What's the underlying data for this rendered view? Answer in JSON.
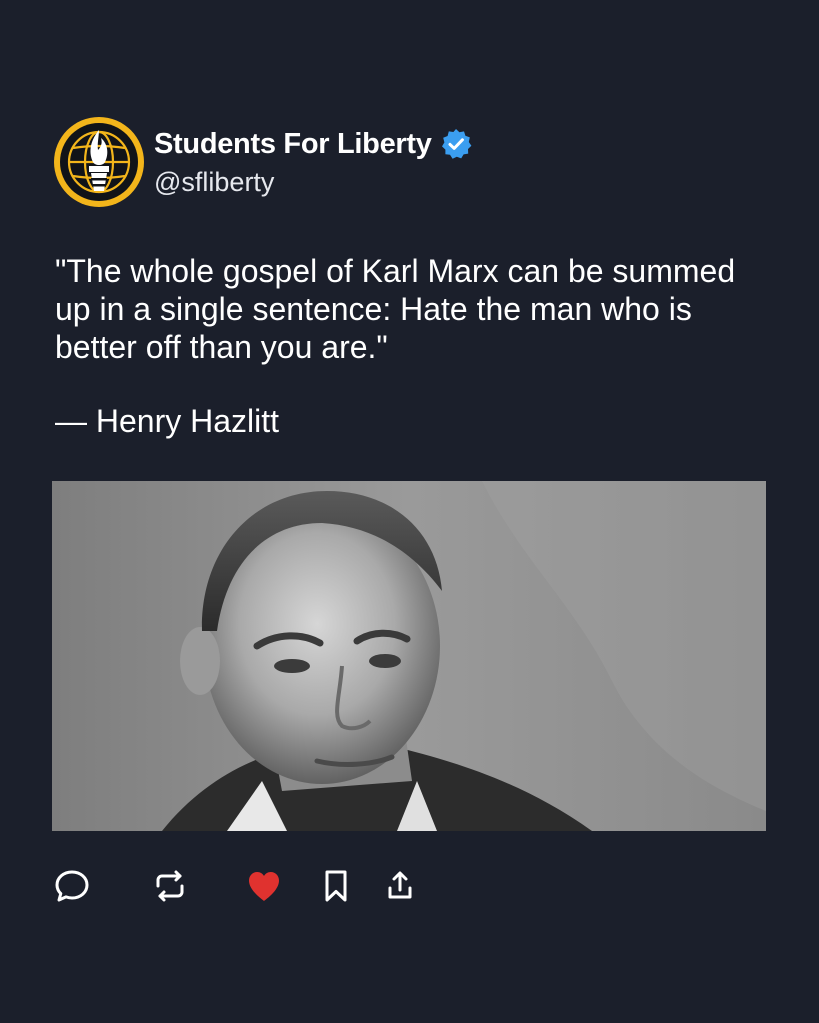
{
  "post": {
    "author": {
      "display_name": "Students For Liberty",
      "handle": "@sfliberty",
      "verified": true,
      "verified_badge_icon": "verified-badge-icon",
      "avatar_icon": "torch-logo-icon"
    },
    "quote_text": "\"The whole gospel of Karl Marx can be summed up in a single sentence: Hate the man who is better off than you are.\"",
    "attribution": "— Henry Hazlitt",
    "photo": {
      "description_icon": "portrait-photo"
    },
    "actions": [
      {
        "name": "reply",
        "icon": "comment-icon"
      },
      {
        "name": "repost",
        "icon": "repost-icon"
      },
      {
        "name": "like",
        "icon": "heart-icon",
        "active": true
      },
      {
        "name": "bookmark",
        "icon": "bookmark-icon"
      },
      {
        "name": "share",
        "icon": "share-icon"
      }
    ]
  },
  "colors": {
    "background": "#1b1f2b",
    "text": "#ffffff",
    "verified_blue": "#3b9ef0",
    "like_red": "#e0322f",
    "logo_gold": "#f3b51b"
  }
}
